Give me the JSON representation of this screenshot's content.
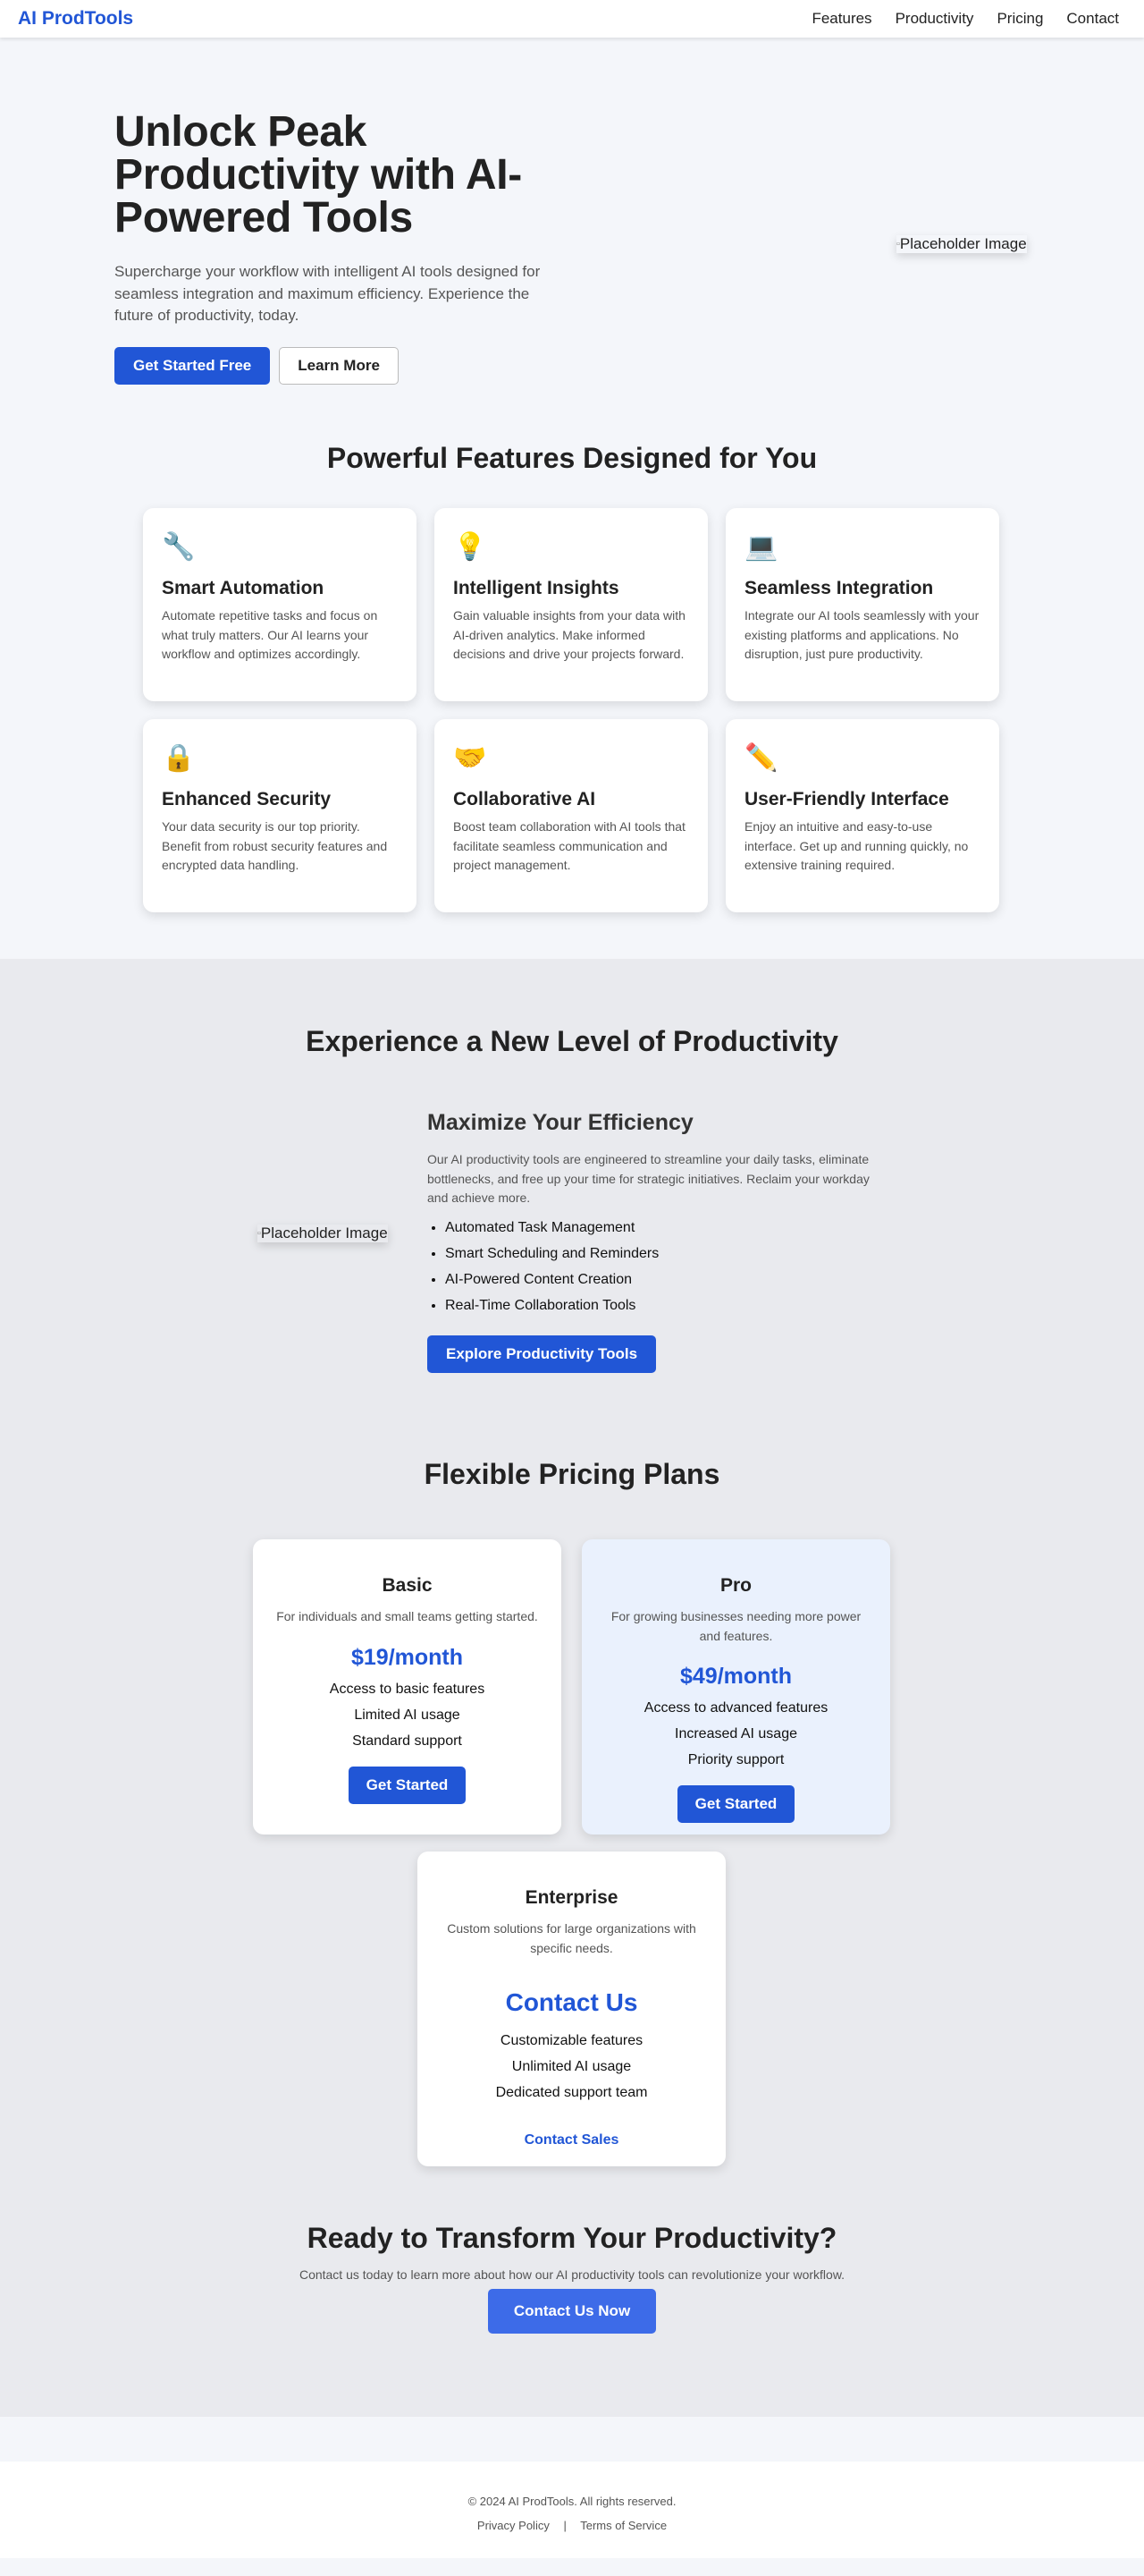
{
  "nav": {
    "logo": "AI ProdTools",
    "links": [
      "Features",
      "Productivity",
      "Pricing",
      "Contact"
    ]
  },
  "hero": {
    "title": "Unlock Peak Productivity with AI-Powered Tools",
    "subtitle": "Supercharge your workflow with intelligent AI tools designed for seamless integration and maximum efficiency. Experience the future of productivity, today.",
    "primary_button": "Get Started Free",
    "secondary_button": "Learn More",
    "image_alt": "Placeholder Image"
  },
  "features": {
    "title": "Powerful Features Designed for You",
    "cards": [
      {
        "icon": "🔧",
        "icon_name": "wrench-icon",
        "title": "Smart Automation",
        "desc": "Automate repetitive tasks and focus on what truly matters. Our AI learns your workflow and optimizes accordingly."
      },
      {
        "icon": "💡",
        "icon_name": "lightbulb-icon",
        "title": "Intelligent Insights",
        "desc": "Gain valuable insights from your data with AI-driven analytics. Make informed decisions and drive your projects forward."
      },
      {
        "icon": "💻",
        "icon_name": "laptop-icon",
        "title": "Seamless Integration",
        "desc": "Integrate our AI tools seamlessly with your existing platforms and applications. No disruption, just pure productivity."
      },
      {
        "icon": "🔒",
        "icon_name": "lock-icon",
        "title": "Enhanced Security",
        "desc": "Your data security is our top priority. Benefit from robust security features and encrypted data handling."
      },
      {
        "icon": "🤝",
        "icon_name": "handshake-icon",
        "title": "Collaborative AI",
        "desc": "Boost team collaboration with AI tools that facilitate seamless communication and project management."
      },
      {
        "icon": "✏️",
        "icon_name": "pencil-icon",
        "title": "User-Friendly Interface",
        "desc": "Enjoy an intuitive and easy-to-use interface. Get up and running quickly, no extensive training required."
      }
    ]
  },
  "productivity": {
    "title": "Experience a New Level of Productivity",
    "image_alt": "Placeholder Image",
    "subtitle": "Maximize Your Efficiency",
    "desc": "Our AI productivity tools are engineered to streamline your daily tasks, eliminate bottlenecks, and free up your time for strategic initiatives. Reclaim your workday and achieve more.",
    "items": [
      "Automated Task Management",
      "Smart Scheduling and Reminders",
      "AI-Powered Content Creation",
      "Real-Time Collaboration Tools"
    ],
    "button": "Explore Productivity Tools"
  },
  "pricing": {
    "title": "Flexible Pricing Plans",
    "plans": [
      {
        "name": "Basic",
        "desc": "For individuals and small teams getting started.",
        "price": "$19/month",
        "features": [
          "Access to basic features",
          "Limited AI usage",
          "Standard support"
        ],
        "button": "Get Started"
      },
      {
        "name": "Pro",
        "desc": "For growing businesses needing more power and features.",
        "price": "$49/month",
        "features": [
          "Access to advanced features",
          "Increased AI usage",
          "Priority support"
        ],
        "button": "Get Started"
      },
      {
        "name": "Enterprise",
        "desc": "Custom solutions for large organizations with specific needs.",
        "price": "Contact Us",
        "features": [
          "Customizable features",
          "Unlimited AI usage",
          "Dedicated support team"
        ],
        "button": "Contact Sales"
      }
    ]
  },
  "cta": {
    "title": "Ready to Transform Your Productivity?",
    "subtitle": "Contact us today to learn more about how our AI productivity tools can revolutionize your workflow.",
    "button": "Contact Us Now"
  },
  "footer": {
    "copyright": "© 2024 AI ProdTools. All rights reserved.",
    "privacy": "Privacy Policy",
    "separator": "|",
    "terms": "Terms of Service"
  },
  "colors": {
    "accent": "#2156d6",
    "cta_button": "#3d6be8",
    "pro_card_bg": "#eaf1fd",
    "section_grey": "#e9eaee",
    "page_bg": "#f4f6fa"
  }
}
